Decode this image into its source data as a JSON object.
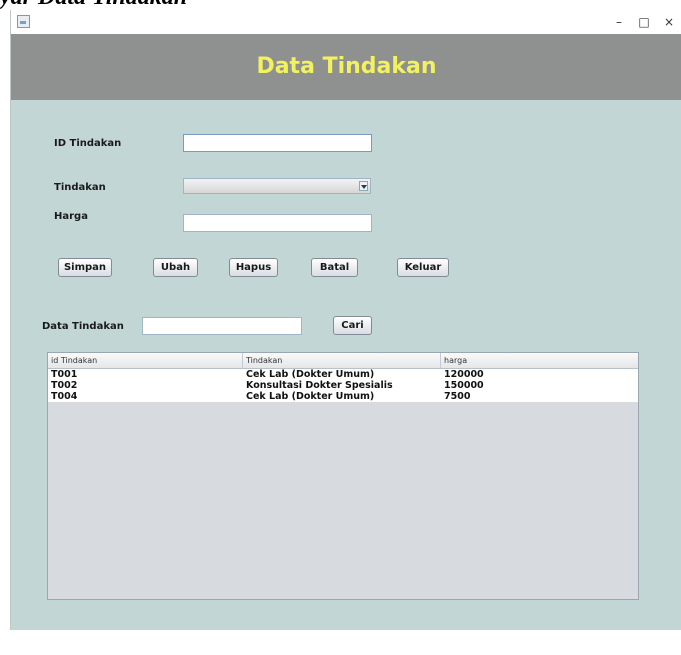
{
  "caption": "yar Data Tindakan",
  "window": {
    "minimize_glyph": "–",
    "maximize_glyph": "□",
    "close_glyph": "×",
    "icon": "java-app-icon"
  },
  "header": {
    "title": "Data Tindakan",
    "bg_color": "#8f9090",
    "title_color": "#f2f25e"
  },
  "form": {
    "id_label": "ID Tindakan",
    "id_value": "",
    "tindakan_label": "Tindakan",
    "tindakan_value": "",
    "harga_label": "Harga",
    "harga_value": ""
  },
  "buttons": {
    "simpan": "Simpan",
    "ubah": "Ubah",
    "hapus": "Hapus",
    "batal": "Batal",
    "keluar": "Keluar"
  },
  "search": {
    "label": "Data Tindakan",
    "value": "",
    "button": "Cari"
  },
  "table": {
    "columns": [
      "id Tindakan",
      "Tindakan",
      "harga"
    ],
    "rows": [
      [
        "T001",
        "Cek Lab (Dokter Umum)",
        "120000"
      ],
      [
        "T002",
        "Konsultasi Dokter Spesialis",
        "150000"
      ],
      [
        "T004",
        "Cek Lab (Dokter Umum)",
        "7500"
      ]
    ]
  },
  "colors": {
    "window_bg": "#c2d6d6",
    "table_bg": "#d7dade"
  }
}
